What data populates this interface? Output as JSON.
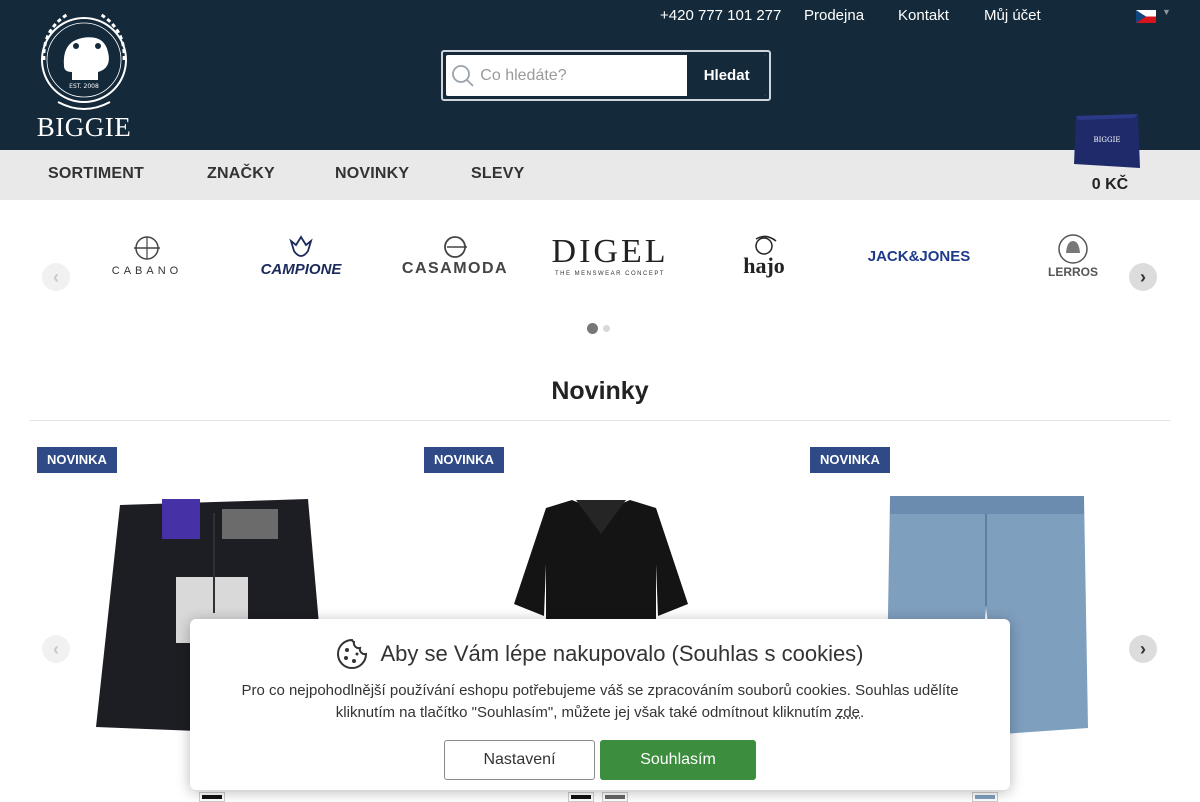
{
  "header": {
    "logo_text": "BIGGIE",
    "logo_est": "EST. 2008",
    "phone": "+420 777 101 277",
    "links": [
      "Prodejna",
      "Kontakt",
      "Můj účet"
    ],
    "search": {
      "placeholder": "Co hledáte?",
      "button": "Hledat"
    },
    "cart_price": "0 KČ"
  },
  "nav": [
    "SORTIMENT",
    "ZNAČKY",
    "NOVINKY",
    "SLEVY"
  ],
  "brands": [
    "CABANO",
    "CAMPIONE",
    "CASAMODA",
    "DIGEL",
    "THE MENSWEAR CONCEPT",
    "hajo",
    "JACK&JONES",
    "LERROS"
  ],
  "section": {
    "title": "Novinky"
  },
  "products": [
    {
      "badge": "NOVINKA",
      "image": "dark jeans",
      "swatches": [
        "#111111"
      ]
    },
    {
      "badge": "NOVINKA",
      "image": "black polo shirt",
      "swatches": [
        "#111111",
        "#666666"
      ]
    },
    {
      "badge": "NOVINKA",
      "image": "denim shorts",
      "swatches": [
        "#7f9fbf"
      ]
    }
  ],
  "cookie": {
    "title": "Aby se Vám lépe nakupovalo (Souhlas s cookies)",
    "text_1": "Pro co nejpohodlnější používání eshopu potřebujeme váš se zpracováním souborů cookies. Souhlas udělíte kliknutím na tlačítko \"Souhlasím\", můžete jej však také odmítnout kliknutím ",
    "link": "zde",
    "text_2": ".",
    "settings_button": "Nastavení",
    "accept_button": "Souhlasím"
  },
  "colors": {
    "header_bg": "#14293a",
    "badge_bg": "#2f4a87",
    "accept_green": "#3d8d3f"
  }
}
